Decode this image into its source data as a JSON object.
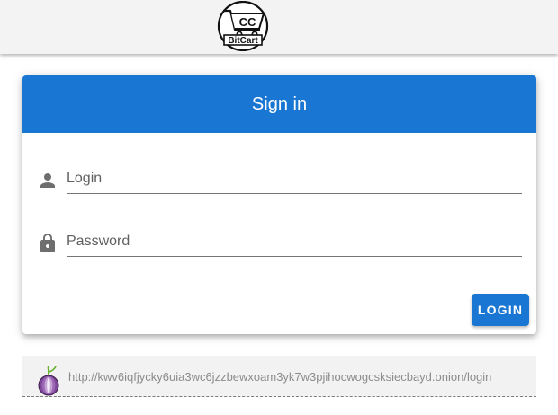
{
  "header": {
    "logo_icon": "bitcart-cart-logo",
    "logo_text": "BitCart",
    "logo_badge": "CC"
  },
  "card": {
    "title": "Sign in",
    "login_field": {
      "icon": "person-icon",
      "placeholder": "Login",
      "value": ""
    },
    "password_field": {
      "icon": "lock-icon",
      "placeholder": "Password",
      "value": ""
    },
    "submit_label": "LOGIN"
  },
  "tor": {
    "icon": "tor-onion-icon",
    "url": "http://kwv6iqfjycky6uia3wc6jzzbewxoam3yk7w3pjihocwogcsksiecbayd.onion/login"
  },
  "colors": {
    "primary": "#1976d2",
    "topbar": "#f3f3f3",
    "tor_bar": "#f2f2f2",
    "tor_text": "#8c8c8c"
  }
}
